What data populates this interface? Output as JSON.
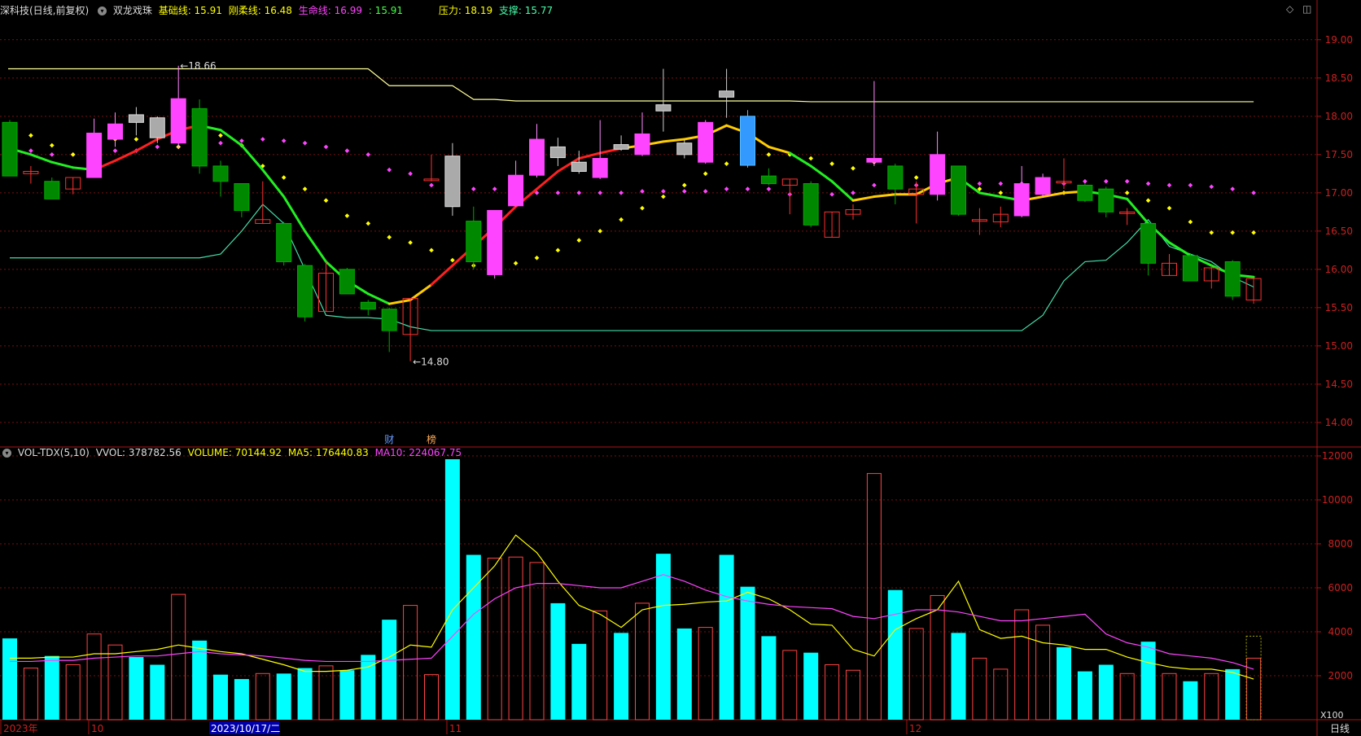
{
  "header": {
    "stock_name": "深科技(日线,前复权)",
    "indicator_name": "双龙戏珠",
    "base_label": "基础线: 15.91",
    "rigid_label": "刚柔线: 16.48",
    "life_label": "生命线: 16.99",
    "extra_label": ": 15.91",
    "pressure_label": "压力: 18.19",
    "support_label": "支撑: 15.77"
  },
  "vol_header": {
    "name": "VOL-TDX(5,10)",
    "vvol": "VVOL: 378782.56",
    "volume": "VOLUME: 70144.92",
    "ma5": "MA5: 176440.83",
    "ma10": "MA10: 224067.75"
  },
  "annotations": {
    "high": "18.66",
    "low": "14.80",
    "fin_mark": "财",
    "rank_mark": "榜"
  },
  "x_axis": {
    "labels": [
      "2023年",
      "10",
      "2023/10/17/二",
      "11",
      "12"
    ],
    "period": "日线",
    "unit": "X100"
  },
  "colors": {
    "up": "#ff44ff",
    "down": "#008800",
    "hollow_up": "#ff3030",
    "gray": "#999999",
    "volume_up": "#00ffff",
    "volume_down": "#ff4444",
    "grid": "#7a1010",
    "axis_text": "#cc2020",
    "pressure": "#ffff99",
    "support": "#44ddaa"
  },
  "chart_data": [
    {
      "type": "candlestick",
      "y_ticks": [
        14.0,
        14.5,
        15.0,
        15.5,
        16.0,
        16.5,
        17.0,
        17.5,
        18.0,
        18.5,
        19.0
      ],
      "ylim": [
        13.85,
        19.2
      ],
      "candles": [
        {
          "o": 17.22,
          "h": 17.95,
          "l": 17.28,
          "c": 17.92,
          "k": "down"
        },
        {
          "o": 17.28,
          "h": 17.35,
          "l": 17.12,
          "c": 17.25,
          "k": "hollow_up"
        },
        {
          "o": 17.15,
          "h": 17.2,
          "l": 16.93,
          "c": 16.92,
          "k": "down"
        },
        {
          "o": 17.05,
          "h": 17.2,
          "l": 16.98,
          "c": 17.2,
          "k": "hollow_up"
        },
        {
          "o": 17.2,
          "h": 17.97,
          "l": 17.2,
          "c": 17.78,
          "k": "up"
        },
        {
          "o": 17.7,
          "h": 18.05,
          "l": 17.6,
          "c": 17.9,
          "k": "up"
        },
        {
          "o": 17.92,
          "h": 18.12,
          "l": 17.75,
          "c": 18.02,
          "k": "gray"
        },
        {
          "o": 17.72,
          "h": 18.0,
          "l": 17.65,
          "c": 17.98,
          "k": "gray"
        },
        {
          "o": 17.65,
          "h": 18.66,
          "l": 17.58,
          "c": 18.23,
          "k": "up"
        },
        {
          "o": 17.35,
          "h": 18.22,
          "l": 17.25,
          "c": 18.1,
          "k": "down"
        },
        {
          "o": 17.15,
          "h": 17.42,
          "l": 16.95,
          "c": 17.35,
          "k": "down"
        },
        {
          "o": 16.77,
          "h": 17.1,
          "l": 16.68,
          "c": 17.12,
          "k": "down"
        },
        {
          "o": 16.6,
          "h": 17.15,
          "l": 16.6,
          "c": 16.65,
          "k": "hollow_up"
        },
        {
          "o": 16.1,
          "h": 16.62,
          "l": 16.05,
          "c": 16.6,
          "k": "down"
        },
        {
          "o": 15.38,
          "h": 16.07,
          "l": 15.32,
          "c": 16.05,
          "k": "down"
        },
        {
          "o": 15.45,
          "h": 16.1,
          "l": 15.45,
          "c": 15.95,
          "k": "hollow_up"
        },
        {
          "o": 15.68,
          "h": 16.02,
          "l": 15.68,
          "c": 16.0,
          "k": "down"
        },
        {
          "o": 15.48,
          "h": 15.6,
          "l": 15.4,
          "c": 15.57,
          "k": "down"
        },
        {
          "o": 15.2,
          "h": 15.5,
          "l": 14.92,
          "c": 15.48,
          "k": "down"
        },
        {
          "o": 15.15,
          "h": 15.62,
          "l": 14.8,
          "c": 15.62,
          "k": "hollow_up"
        },
        {
          "o": 17.18,
          "h": 17.5,
          "l": 17.15,
          "c": 17.18,
          "k": "hollow_up"
        },
        {
          "o": 16.82,
          "h": 17.65,
          "l": 16.7,
          "c": 17.48,
          "k": "gray"
        },
        {
          "o": 16.1,
          "h": 16.82,
          "l": 16.0,
          "c": 16.63,
          "k": "down"
        },
        {
          "o": 15.93,
          "h": 16.77,
          "l": 15.88,
          "c": 16.77,
          "k": "up"
        },
        {
          "o": 16.83,
          "h": 17.42,
          "l": 16.82,
          "c": 17.23,
          "k": "up"
        },
        {
          "o": 17.23,
          "h": 17.9,
          "l": 17.2,
          "c": 17.7,
          "k": "up"
        },
        {
          "o": 17.46,
          "h": 17.72,
          "l": 17.35,
          "c": 17.6,
          "k": "gray"
        },
        {
          "o": 17.28,
          "h": 17.55,
          "l": 17.25,
          "c": 17.4,
          "k": "gray"
        },
        {
          "o": 17.2,
          "h": 17.95,
          "l": 17.18,
          "c": 17.45,
          "k": "up"
        },
        {
          "o": 17.57,
          "h": 17.75,
          "l": 17.55,
          "c": 17.63,
          "k": "gray"
        },
        {
          "o": 17.5,
          "h": 18.05,
          "l": 17.48,
          "c": 17.77,
          "k": "up"
        },
        {
          "o": 18.07,
          "h": 18.62,
          "l": 17.8,
          "c": 18.15,
          "k": "gray"
        },
        {
          "o": 17.5,
          "h": 17.7,
          "l": 17.45,
          "c": 17.65,
          "k": "gray"
        },
        {
          "o": 17.4,
          "h": 17.95,
          "l": 17.38,
          "c": 17.92,
          "k": "up"
        },
        {
          "o": 18.25,
          "h": 18.62,
          "l": 17.98,
          "c": 18.33,
          "k": "gray"
        },
        {
          "o": 17.36,
          "h": 18.08,
          "l": 17.33,
          "c": 18.0,
          "k": "blue"
        },
        {
          "o": 17.12,
          "h": 17.32,
          "l": 17.1,
          "c": 17.22,
          "k": "down"
        },
        {
          "o": 17.1,
          "h": 17.18,
          "l": 16.72,
          "c": 17.18,
          "k": "hollow_up"
        },
        {
          "o": 16.58,
          "h": 17.15,
          "l": 16.55,
          "c": 17.12,
          "k": "down"
        },
        {
          "o": 16.42,
          "h": 16.75,
          "l": 16.42,
          "c": 16.75,
          "k": "hollow_up"
        },
        {
          "o": 16.72,
          "h": 16.85,
          "l": 16.65,
          "c": 16.78,
          "k": "hollow_up"
        },
        {
          "o": 17.4,
          "h": 18.46,
          "l": 17.35,
          "c": 17.45,
          "k": "up"
        },
        {
          "o": 17.05,
          "h": 17.38,
          "l": 16.85,
          "c": 17.35,
          "k": "down"
        },
        {
          "o": 16.98,
          "h": 17.15,
          "l": 16.6,
          "c": 17.05,
          "k": "hollow_up"
        },
        {
          "o": 16.98,
          "h": 17.8,
          "l": 16.9,
          "c": 17.5,
          "k": "up"
        },
        {
          "o": 16.72,
          "h": 17.3,
          "l": 16.7,
          "c": 17.35,
          "k": "down"
        },
        {
          "o": 16.65,
          "h": 16.8,
          "l": 16.45,
          "c": 16.65,
          "k": "hollow_up"
        },
        {
          "o": 16.62,
          "h": 16.82,
          "l": 16.55,
          "c": 16.72,
          "k": "hollow_up"
        },
        {
          "o": 16.7,
          "h": 17.35,
          "l": 16.68,
          "c": 17.12,
          "k": "up"
        },
        {
          "o": 16.98,
          "h": 17.25,
          "l": 16.95,
          "c": 17.2,
          "k": "up"
        },
        {
          "o": 17.15,
          "h": 17.45,
          "l": 17.05,
          "c": 17.15,
          "k": "hollow_up"
        },
        {
          "o": 16.9,
          "h": 17.12,
          "l": 16.88,
          "c": 17.1,
          "k": "down"
        },
        {
          "o": 16.75,
          "h": 17.08,
          "l": 16.68,
          "c": 17.05,
          "k": "down"
        },
        {
          "o": 16.75,
          "h": 16.8,
          "l": 16.58,
          "c": 16.75,
          "k": "hollow_up"
        },
        {
          "o": 16.08,
          "h": 16.6,
          "l": 15.92,
          "c": 16.6,
          "k": "down"
        },
        {
          "o": 15.92,
          "h": 16.2,
          "l": 15.92,
          "c": 16.08,
          "k": "hollow_up"
        },
        {
          "o": 15.85,
          "h": 16.2,
          "l": 15.85,
          "c": 16.18,
          "k": "down"
        },
        {
          "o": 15.85,
          "h": 16.05,
          "l": 15.75,
          "c": 16.02,
          "k": "hollow_up"
        },
        {
          "o": 15.65,
          "h": 16.12,
          "l": 15.6,
          "c": 16.1,
          "k": "down"
        },
        {
          "o": 15.6,
          "h": 15.88,
          "l": 15.55,
          "c": 15.88,
          "k": "hollow_up"
        }
      ],
      "life_line": [
        17.58,
        17.5,
        17.4,
        17.33,
        17.3,
        17.42,
        17.55,
        17.7,
        17.82,
        17.88,
        17.82,
        17.62,
        17.3,
        16.95,
        16.5,
        16.1,
        15.85,
        15.68,
        15.55,
        15.6,
        15.8,
        16.05,
        16.3,
        16.55,
        16.82,
        17.05,
        17.28,
        17.45,
        17.52,
        17.58,
        17.62,
        17.67,
        17.7,
        17.75,
        17.88,
        17.78,
        17.6,
        17.52,
        17.35,
        17.15,
        16.9,
        16.95,
        16.98,
        16.98,
        17.12,
        17.2,
        17.0,
        16.95,
        16.9,
        16.95,
        17.0,
        17.02,
        16.98,
        16.92,
        16.6,
        16.35,
        16.18,
        16.05,
        15.93,
        15.9
      ],
      "pressure_line": [
        18.62,
        18.62,
        18.62,
        18.62,
        18.62,
        18.62,
        18.62,
        18.62,
        18.62,
        18.62,
        18.62,
        18.62,
        18.62,
        18.62,
        18.62,
        18.62,
        18.62,
        18.62,
        18.4,
        18.4,
        18.4,
        18.4,
        18.22,
        18.22,
        18.2,
        18.2,
        18.2,
        18.2,
        18.2,
        18.2,
        18.2,
        18.2,
        18.2,
        18.2,
        18.2,
        18.2,
        18.2,
        18.2,
        18.19,
        18.19,
        18.19,
        18.19,
        18.19,
        18.19,
        18.19,
        18.19,
        18.19,
        18.19,
        18.19,
        18.19,
        18.19,
        18.19,
        18.19,
        18.19,
        18.19,
        18.19,
        18.19,
        18.19,
        18.19,
        18.19
      ],
      "support_line": [
        16.15,
        16.15,
        16.15,
        16.15,
        16.15,
        16.15,
        16.15,
        16.15,
        16.15,
        16.15,
        16.2,
        16.5,
        16.85,
        16.6,
        16.0,
        15.4,
        15.37,
        15.37,
        15.35,
        15.25,
        15.2,
        15.2,
        15.2,
        15.2,
        15.2,
        15.2,
        15.2,
        15.2,
        15.2,
        15.2,
        15.2,
        15.2,
        15.2,
        15.2,
        15.2,
        15.2,
        15.2,
        15.2,
        15.2,
        15.2,
        15.2,
        15.2,
        15.2,
        15.2,
        15.2,
        15.2,
        15.2,
        15.2,
        15.2,
        15.4,
        15.85,
        16.1,
        16.12,
        16.35,
        16.65,
        16.3,
        16.2,
        16.1,
        15.9,
        15.77
      ],
      "magenta_dots": [
        17.55,
        17.55,
        17.5,
        17.5,
        17.6,
        17.55,
        17.55,
        17.6,
        17.6,
        17.6,
        17.65,
        17.68,
        17.7,
        17.68,
        17.65,
        17.6,
        17.55,
        17.5,
        17.3,
        17.25,
        17.1,
        17.05,
        17.05,
        17.05,
        17.05,
        17.0,
        17.0,
        17.0,
        17.0,
        17.0,
        17.02,
        17.02,
        17.02,
        17.02,
        17.05,
        17.05,
        17.05,
        16.98,
        16.98,
        16.98,
        17.0,
        17.1,
        17.1,
        17.1,
        17.15,
        17.12,
        17.12,
        17.12,
        17.12,
        17.12,
        17.12,
        17.15,
        17.15,
        17.15,
        17.12,
        17.1,
        17.1,
        17.08,
        17.05,
        17.0
      ],
      "yellow_dots": [
        17.85,
        17.75,
        17.62,
        17.5,
        17.65,
        17.7,
        17.7,
        17.75,
        17.6,
        17.85,
        17.75,
        17.62,
        17.35,
        17.2,
        17.05,
        16.9,
        16.7,
        16.6,
        16.42,
        16.35,
        16.25,
        16.12,
        16.05,
        16.0,
        16.08,
        16.15,
        16.25,
        16.38,
        16.5,
        16.65,
        16.8,
        16.95,
        17.1,
        17.25,
        17.38,
        17.45,
        17.5,
        17.5,
        17.45,
        17.38,
        17.32,
        17.4,
        17.3,
        17.2,
        17.15,
        17.05,
        17.05,
        17.0,
        17.0,
        17.0,
        17.0,
        17.0,
        17.0,
        17.0,
        16.9,
        16.8,
        16.62,
        16.48,
        16.48,
        16.48
      ]
    },
    {
      "type": "bar",
      "series_name": "VOLUME",
      "y_ticks": [
        2000,
        4000,
        6000,
        8000,
        10000,
        12000
      ],
      "ylim": [
        0,
        12000
      ],
      "volumes": [
        3700,
        2350,
        2900,
        2500,
        3900,
        3400,
        2850,
        2500,
        5700,
        3600,
        2050,
        1850,
        2100,
        2100,
        2350,
        2450,
        2250,
        2950,
        4550,
        5200,
        2050,
        11850,
        7500,
        7350,
        7400,
        7150,
        5300,
        3450,
        4950,
        3950,
        5300,
        7550,
        4150,
        4200,
        7500,
        6050,
        3800,
        3150,
        3050,
        2500,
        2250,
        11200,
        5900,
        4150,
        5650,
        3950,
        2800,
        2300,
        5000,
        4300,
        3300,
        2200,
        2500,
        2100,
        3550,
        2100,
        1750,
        2100,
        2300,
        2800
      ],
      "vol_kind": [
        "f",
        "h",
        "f",
        "h",
        "h",
        "h",
        "f",
        "f",
        "h",
        "f",
        "f",
        "f",
        "h",
        "f",
        "f",
        "h",
        "f",
        "f",
        "f",
        "h",
        "h",
        "f",
        "f",
        "h",
        "h",
        "h",
        "f",
        "f",
        "h",
        "f",
        "h",
        "f",
        "f",
        "h",
        "f",
        "f",
        "f",
        "h",
        "f",
        "h",
        "h",
        "h",
        "f",
        "h",
        "h",
        "f",
        "h",
        "h",
        "h",
        "h",
        "f",
        "f",
        "f",
        "h",
        "f",
        "h",
        "f",
        "h",
        "f",
        "h"
      ],
      "ma5": [
        2800,
        2800,
        2850,
        2850,
        3000,
        3000,
        3100,
        3200,
        3400,
        3250,
        3100,
        3000,
        2750,
        2500,
        2200,
        2200,
        2250,
        2400,
        2850,
        3400,
        3300,
        5000,
        6000,
        7000,
        8400,
        7600,
        6300,
        5200,
        4800,
        4200,
        5000,
        5200,
        5250,
        5350,
        5400,
        5800,
        5500,
        5000,
        4350,
        4300,
        3200,
        2900,
        4100,
        4600,
        5000,
        6300,
        4100,
        3700,
        3800,
        3500,
        3400,
        3200,
        3200,
        2850,
        2600,
        2400,
        2300,
        2300,
        2150,
        1850
      ],
      "ma10": [
        2650,
        2650,
        2700,
        2700,
        2800,
        2850,
        2900,
        2900,
        3000,
        3100,
        3000,
        2950,
        2900,
        2800,
        2700,
        2650,
        2650,
        2650,
        2700,
        2750,
        2800,
        3800,
        4800,
        5500,
        6000,
        6200,
        6200,
        6100,
        6000,
        6000,
        6300,
        6600,
        6300,
        5900,
        5600,
        5400,
        5250,
        5150,
        5100,
        5050,
        4700,
        4600,
        4800,
        5000,
        5000,
        4900,
        4700,
        4500,
        4500,
        4600,
        4700,
        4800,
        3900,
        3500,
        3300,
        3000,
        2900,
        2800,
        2600,
        2300
      ]
    }
  ]
}
